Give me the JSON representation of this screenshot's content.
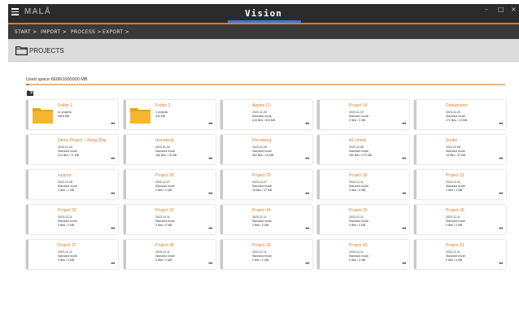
{
  "app": {
    "logo": "MALÅ",
    "title": "Vision"
  },
  "window_controls": {
    "minimize": "–",
    "maximize": "□",
    "close": "×"
  },
  "breadcrumb": [
    "START >",
    "IMPORT >",
    "PROCESS >",
    "EXPORT >"
  ],
  "page": {
    "title": "PROJECTS"
  },
  "storage": {
    "used_text": "Used space 6606/1000000 MB",
    "used_fraction": 0.0066
  },
  "colors": {
    "accent": "#e07b2a",
    "titlebar": "#2b2b2b",
    "toolbar": "#3a3a3a",
    "folder": "#f5b731"
  },
  "projects": [
    {
      "name": "Folder 1",
      "type": "folder",
      "l1": "11 projects",
      "l2": "4659 MB",
      "l3": ""
    },
    {
      "name": "Folder 2",
      "type": "folder",
      "l1": "3 projects",
      "l2": "300 MB",
      "l3": ""
    },
    {
      "name": "Apples (1)",
      "type": "project",
      "l1": "2022-11-28",
      "l2": "Standard mode",
      "l3": "415 files / 515 MB"
    },
    {
      "name": "Project 18",
      "type": "project",
      "l1": "2023-11-15",
      "l2": "Standard mode",
      "l3": "0 files / 0 MB"
    },
    {
      "name": "Dinkastaren",
      "type": "project",
      "l1": "2023-11-20",
      "l2": "Standard mode",
      "l3": "272 files / 10 MB"
    },
    {
      "name": "Demo Project - Viking Ship",
      "type": "project",
      "l1": "2023-12-04",
      "l2": "Standard mode",
      "l3": "414 files / 71 MB"
    },
    {
      "name": "hornsberg",
      "type": "project",
      "l1": "2023-01-05",
      "l2": "Standard mode",
      "l3": "455 files / 18 MB"
    },
    {
      "name": "Hornsberg",
      "type": "project",
      "l1": "2023-12-05",
      "l2": "Standard mode",
      "l3": "384 files / 10 MB"
    },
    {
      "name": "A1 Umeå",
      "type": "project",
      "l1": "2023-12-08",
      "l2": "Standard mode",
      "l3": "282 files / 270 MB"
    },
    {
      "name": "Snake",
      "type": "project",
      "l1": "2023-12-08",
      "l2": "Standard mode",
      "l3": "15 files / 37 MB"
    },
    {
      "name": "support",
      "type": "project",
      "l1": "2023-12-08",
      "l2": "Standard mode",
      "l3": "2 files / 1 MB"
    },
    {
      "name": "Project 28",
      "type": "project",
      "l1": "2023-12-07",
      "l2": "Standard mode",
      "l3": "0 files / 0 MB"
    },
    {
      "name": "Project 29",
      "type": "project",
      "l1": "2023-12-07",
      "l2": "Standard mode",
      "l3": "18 files / 37 MB"
    },
    {
      "name": "Project 30",
      "type": "project",
      "l1": "2023-12-11",
      "l2": "Standard mode",
      "l3": "0 files / 0 MB"
    },
    {
      "name": "Project 31",
      "type": "project",
      "l1": "2023-12-11",
      "l2": "Standard mode",
      "l3": "0 files / 0 MB"
    },
    {
      "name": "Project 32",
      "type": "project",
      "l1": "2023-12-11",
      "l2": "Standard mode",
      "l3": "0 files / 0 MB"
    },
    {
      "name": "Project 33",
      "type": "project",
      "l1": "2023-12-11",
      "l2": "Standard mode",
      "l3": "0 files / 0 MB"
    },
    {
      "name": "Project 34",
      "type": "project",
      "l1": "2023-12-11",
      "l2": "Standard mode",
      "l3": "0 files / 0 MB"
    },
    {
      "name": "Project 35",
      "type": "project",
      "l1": "2023-12-11",
      "l2": "Standard mode",
      "l3": "0 files / 0 MB"
    },
    {
      "name": "Project 36",
      "type": "project",
      "l1": "2023-12-11",
      "l2": "Standard mode",
      "l3": "0 files / 0 MB"
    },
    {
      "name": "Project 37",
      "type": "project",
      "l1": "2023-12-11",
      "l2": "Standard mode",
      "l3": "0 files / 0 MB"
    },
    {
      "name": "Project 38",
      "type": "project",
      "l1": "2023-12-11",
      "l2": "Standard mode",
      "l3": "0 files / 0 MB"
    },
    {
      "name": "Project 39",
      "type": "project",
      "l1": "2023-12-11",
      "l2": "Standard mode",
      "l3": "0 files / 0 MB"
    },
    {
      "name": "Project 40",
      "type": "project",
      "l1": "2023-12-11",
      "l2": "Standard mode",
      "l3": "0 files / 0 MB"
    },
    {
      "name": "Project 41",
      "type": "project",
      "l1": "2023-12-11",
      "l2": "Standard mode",
      "l3": "0 files / 0 MB"
    }
  ],
  "card_menu_label": "•••"
}
